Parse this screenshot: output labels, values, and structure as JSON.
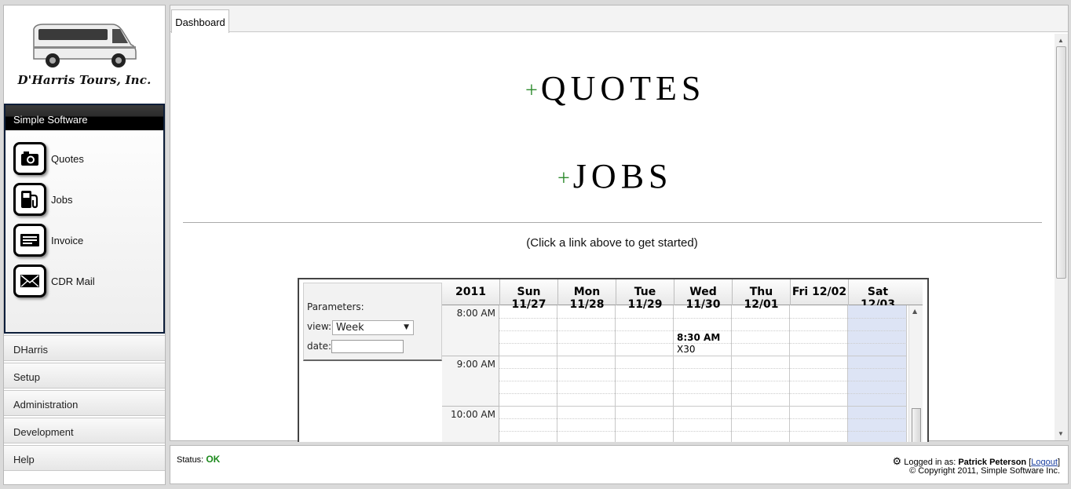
{
  "sidebar": {
    "company_name": "D'Harris Tours, Inc.",
    "module_title": "Simple Software",
    "modules": [
      {
        "label": "Quotes",
        "icon": "camera-icon"
      },
      {
        "label": "Jobs",
        "icon": "fuel-pump-icon"
      },
      {
        "label": "Invoice",
        "icon": "invoice-icon"
      },
      {
        "label": "CDR Mail",
        "icon": "mail-icon"
      }
    ],
    "sections": [
      "DHarris",
      "Setup",
      "Administration",
      "Development",
      "Help"
    ]
  },
  "tabs": [
    "Dashboard"
  ],
  "dashboard": {
    "plus_symbol": "+",
    "quotes_link": "QUOTES",
    "jobs_link": "JOBS",
    "hint": "(Click a link above to get started)"
  },
  "calendar": {
    "params_title": "Parameters:",
    "view_label": "view:",
    "view_value": "Week",
    "date_label": "date:",
    "year": "2011",
    "days": [
      "Sun 11/27",
      "Mon 11/28",
      "Tue 11/29",
      "Wed 11/30",
      "Thu 12/01",
      "Fri 12/02",
      "Sat 12/03"
    ],
    "times": [
      "8:00 AM",
      "9:00 AM",
      "10:00 AM"
    ],
    "event": {
      "time": "8:30 AM",
      "title": "X30",
      "day": "Wed 11/30"
    },
    "highlight_day": "Sat 12/03"
  },
  "footer": {
    "status_label": "Status:",
    "status_value": "OK",
    "logged_in_label": "Logged in as:",
    "user": "Patrick Peterson",
    "logout": "Logout",
    "copyright": "© Copyright 2011, Simple Software Inc."
  },
  "colors": {
    "accent_green": "#2e8b2e",
    "status_ok": "#1d8a1d",
    "module_header": "#000000",
    "highlight_day": "#dde4f5"
  }
}
